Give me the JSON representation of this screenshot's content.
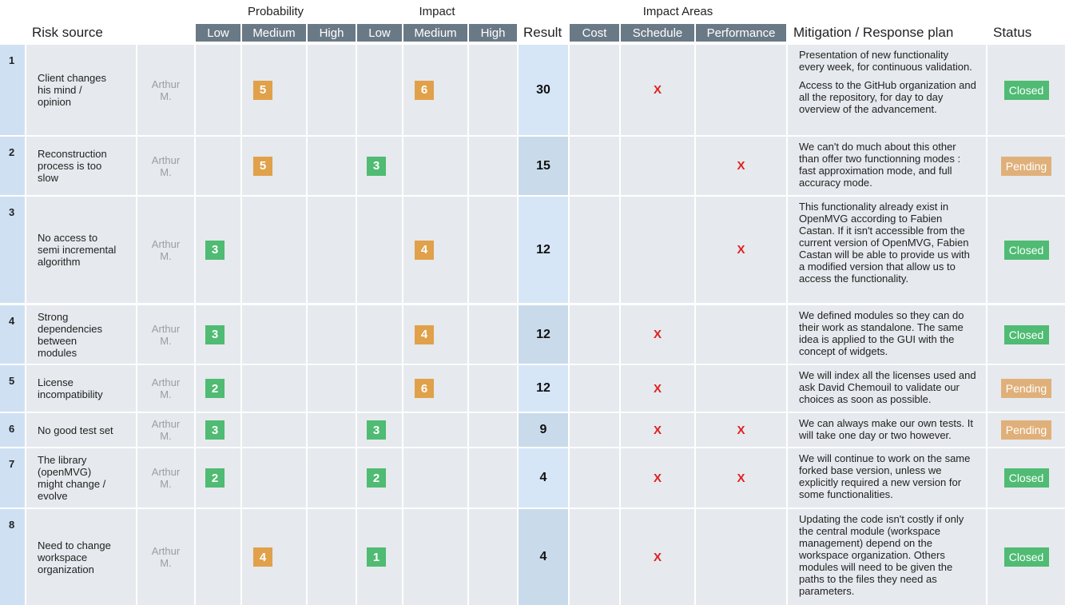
{
  "header": {
    "group_probability": "Probability",
    "group_impact": "Impact",
    "group_impact_areas": "Impact Areas",
    "risk_source": "Risk source",
    "prob_low": "Low",
    "prob_medium": "Medium",
    "prob_high": "High",
    "imp_low": "Low",
    "imp_medium": "Medium",
    "imp_high": "High",
    "result": "Result",
    "cost": "Cost",
    "schedule": "Schedule",
    "performance": "Performance",
    "mitigation": "Mitigation / Response plan",
    "status": "Status"
  },
  "colors": {
    "header_bg": "#6a7986",
    "cell_bg": "#e6e9ed",
    "number_col_bg": "#cfe0f3",
    "badge_green": "#4fbb73",
    "badge_orange": "#e0a14a",
    "x_mark": "#e02020",
    "status_closed": "#4fbb73",
    "status_pending": "#e0b07a"
  },
  "mark": "X",
  "rows": [
    {
      "num": "1",
      "source": "Client changes his mind / opinion",
      "owner": "Arthur M.",
      "probability": {
        "level": "medium",
        "value": "5",
        "color": "orange"
      },
      "impact": {
        "level": "medium",
        "value": "6",
        "color": "orange"
      },
      "result": "30",
      "areas": {
        "cost": false,
        "schedule": true,
        "performance": false
      },
      "mitigation": [
        "Presentation of new functionality every week, for continuous validation.",
        "Access to the GitHub organization and all the repository, for day to day overview of the advancement."
      ],
      "status": "Closed"
    },
    {
      "num": "2",
      "source": "Reconstruction process is too slow",
      "owner": "Arthur M.",
      "probability": {
        "level": "medium",
        "value": "5",
        "color": "orange"
      },
      "impact": {
        "level": "low",
        "value": "3",
        "color": "green"
      },
      "result": "15",
      "areas": {
        "cost": false,
        "schedule": false,
        "performance": true
      },
      "mitigation": [
        "We can't do much about this other than offer two functionning modes : fast approximation mode, and full accuracy mode."
      ],
      "status": "Pending"
    },
    {
      "num": "3",
      "source": "No access to semi incremental algorithm",
      "owner": "Arthur M.",
      "probability": {
        "level": "low",
        "value": "3",
        "color": "green"
      },
      "impact": {
        "level": "medium",
        "value": "4",
        "color": "orange"
      },
      "result": "12",
      "areas": {
        "cost": false,
        "schedule": false,
        "performance": true
      },
      "mitigation": [
        "This functionality already exist in OpenMVG according to Fabien Castan. If it isn't accessible from the current version of OpenMVG, Fabien Castan will be able to provide us with a modified version that allow us to access the functionality."
      ],
      "status": "Closed"
    },
    {
      "num": "4",
      "source": "Strong dependencies between modules",
      "owner": "Arthur M.",
      "probability": {
        "level": "low",
        "value": "3",
        "color": "green"
      },
      "impact": {
        "level": "medium",
        "value": "4",
        "color": "orange"
      },
      "result": "12",
      "areas": {
        "cost": false,
        "schedule": true,
        "performance": false
      },
      "mitigation": [
        "We defined modules so they can do their work as standalone. The same idea is applied to the GUI with the concept of widgets."
      ],
      "status": "Closed"
    },
    {
      "num": "5",
      "source": "License incompatibility",
      "owner": "Arthur M.",
      "probability": {
        "level": "low",
        "value": "2",
        "color": "green"
      },
      "impact": {
        "level": "medium",
        "value": "6",
        "color": "orange"
      },
      "result": "12",
      "areas": {
        "cost": false,
        "schedule": true,
        "performance": false
      },
      "mitigation": [
        "We will index all the licenses used and ask David Chemouil to validate our choices as soon as possible."
      ],
      "status": "Pending"
    },
    {
      "num": "6",
      "source": "No good test set",
      "owner": "Arthur M.",
      "probability": {
        "level": "low",
        "value": "3",
        "color": "green"
      },
      "impact": {
        "level": "low",
        "value": "3",
        "color": "green"
      },
      "result": "9",
      "areas": {
        "cost": false,
        "schedule": true,
        "performance": true
      },
      "mitigation": [
        "We can always make our own tests. It will take one day or two however."
      ],
      "status": "Pending"
    },
    {
      "num": "7",
      "source": "The library (openMVG) might change / evolve",
      "owner": "Arthur M.",
      "probability": {
        "level": "low",
        "value": "2",
        "color": "green"
      },
      "impact": {
        "level": "low",
        "value": "2",
        "color": "green"
      },
      "result": "4",
      "areas": {
        "cost": false,
        "schedule": true,
        "performance": true
      },
      "mitigation": [
        "We will continue to work on the same forked base version, unless we explicitly required a new version for some functionalities."
      ],
      "status": "Closed"
    },
    {
      "num": "8",
      "source": "Need to change workspace organization",
      "owner": "Arthur M.",
      "probability": {
        "level": "medium",
        "value": "4",
        "color": "orange"
      },
      "impact": {
        "level": "low",
        "value": "1",
        "color": "green"
      },
      "result": "4",
      "areas": {
        "cost": false,
        "schedule": true,
        "performance": false
      },
      "mitigation": [
        "Updating the code isn't costly if only the central module (workspace management) depend on the workspace organization. Others modules will need to be given the paths to the files they need as parameters."
      ],
      "status": "Closed"
    }
  ]
}
